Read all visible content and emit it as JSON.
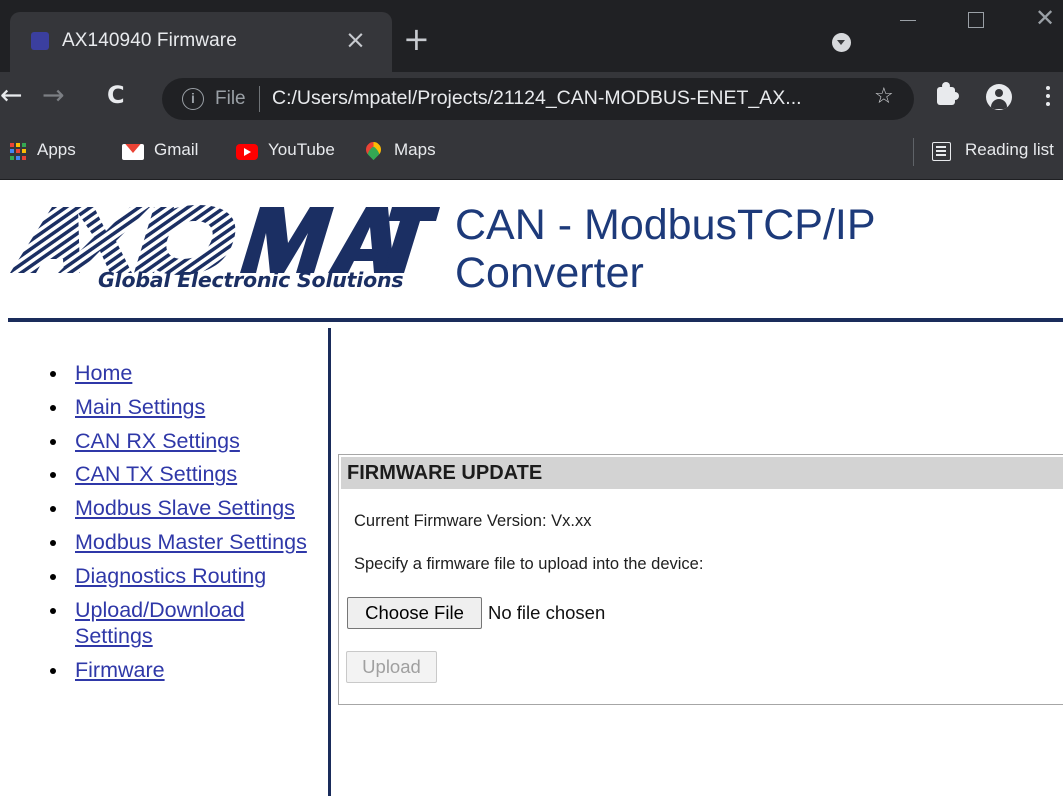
{
  "browser": {
    "tab": {
      "title": "AX140940 Firmware",
      "close_glyph": "×"
    },
    "new_tab_glyph": "+",
    "nav": {
      "back_glyph": "←",
      "forward_glyph": "→",
      "reload_glyph": "C"
    },
    "address": {
      "info_glyph": "i",
      "scheme": "File",
      "url": "C:/Users/mpatel/Projects/21124_CAN-MODBUS-ENET_AX...",
      "star_glyph": "☆"
    },
    "bookmarks": [
      {
        "label": "Apps",
        "icon": "apps-icon"
      },
      {
        "label": "Gmail",
        "icon": "gmail-icon"
      },
      {
        "label": "YouTube",
        "icon": "youtube-icon"
      },
      {
        "label": "Maps",
        "icon": "maps-icon"
      }
    ],
    "reading_list": "Reading list",
    "window": {
      "minimize_glyph": "—",
      "close_glyph": "✕"
    }
  },
  "site": {
    "logo_text": "AXIOMATIC",
    "logo_tagline": "Global Electronic Solutions",
    "title": "CAN - ModbusTCP/IP\nConverter"
  },
  "nav_items": [
    {
      "label": "Home"
    },
    {
      "label": "Main Settings"
    },
    {
      "label": "CAN RX Settings"
    },
    {
      "label": "CAN TX Settings"
    },
    {
      "label": "Modbus Slave Settings"
    },
    {
      "label": "Modbus Master Settings"
    },
    {
      "label": "Diagnostics Routing"
    },
    {
      "label": "Upload/Download Settings"
    },
    {
      "label": "Firmware"
    }
  ],
  "firmware": {
    "heading": "FIRMWARE UPDATE",
    "current_version": "Current Firmware Version: Vx.xx",
    "instructions": "Specify a firmware file to upload into the device:",
    "choose_button": "Choose File",
    "file_status": "No file chosen",
    "upload_button": "Upload"
  },
  "colors": {
    "brand_navy": "#1a2c5b",
    "title_blue": "#1d3a7a",
    "link": "#2f38a8",
    "chrome_dark": "#202124",
    "chrome_toolbar": "#35363a"
  }
}
